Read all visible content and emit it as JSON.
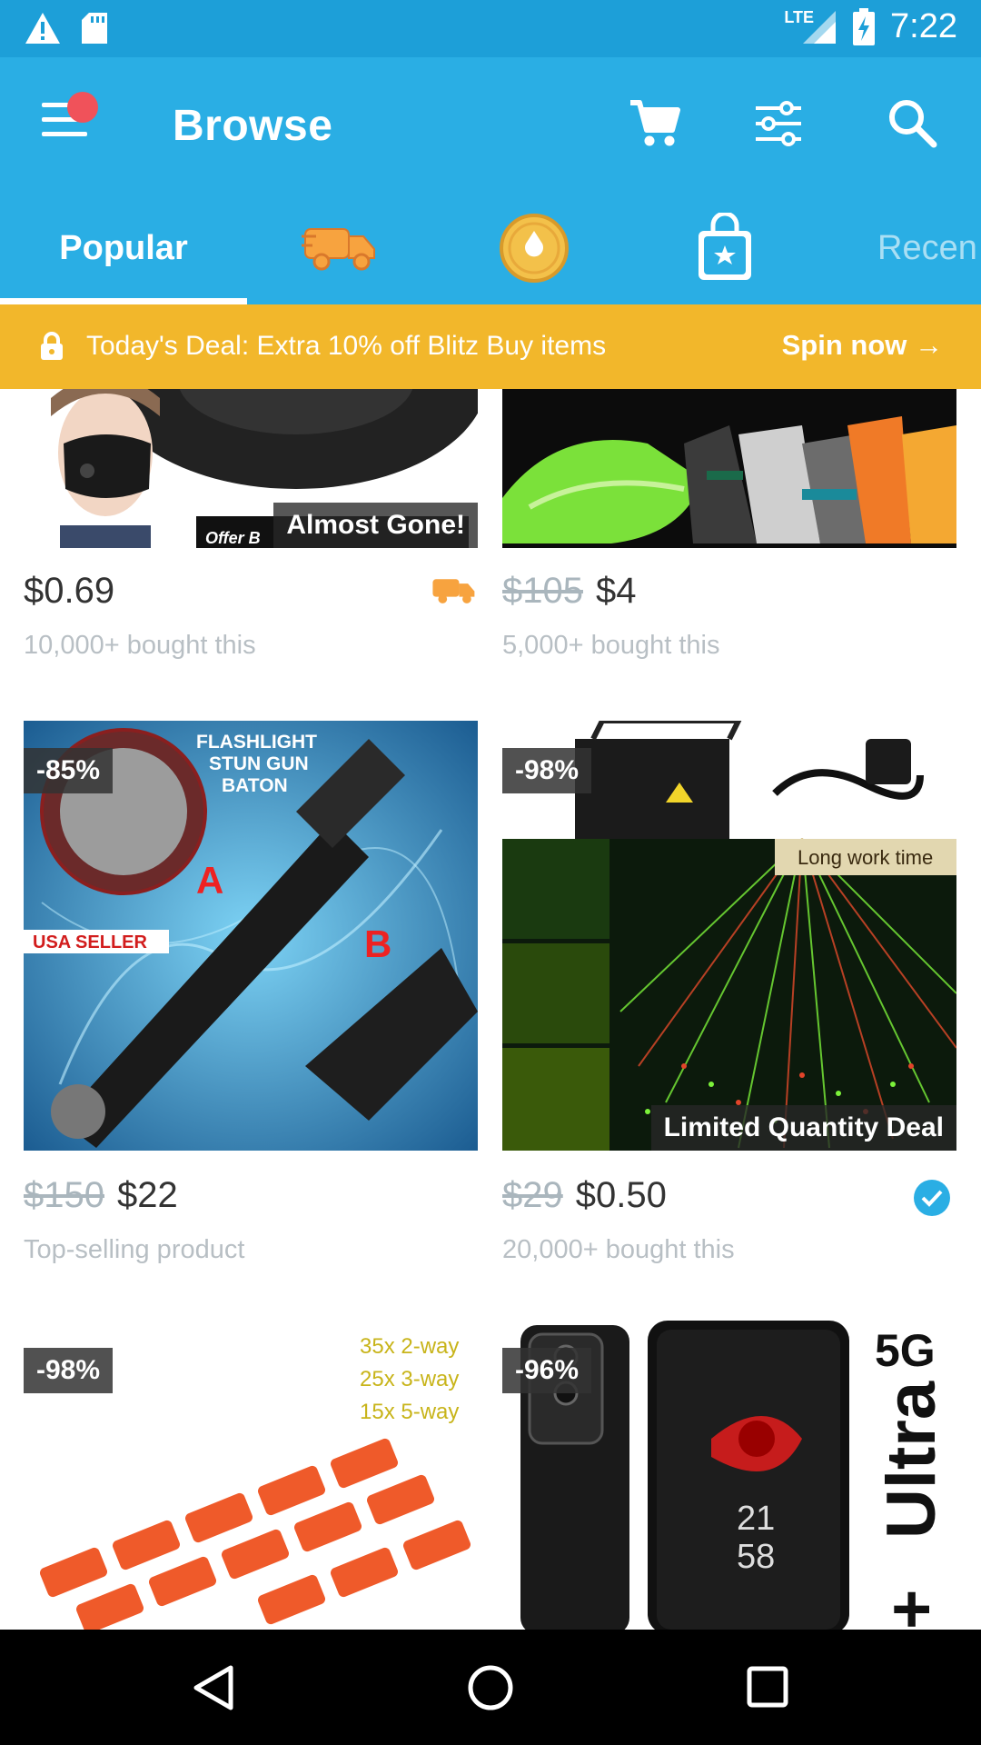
{
  "status_bar": {
    "time": "7:22",
    "network": "LTE"
  },
  "app_bar": {
    "title": "Browse",
    "icons": [
      "menu-icon",
      "cart-icon",
      "filter-icon",
      "search-icon"
    ]
  },
  "tabs": {
    "popular": "Popular",
    "recent": "Recen",
    "icon_tabs": [
      "delivery-truck-icon",
      "gold-coin-icon",
      "shopping-bag-icon"
    ]
  },
  "deal_banner": {
    "text": "Today's Deal: Extra 10% off Blitz Buy items",
    "action": "Spin now"
  },
  "products": [
    {
      "price": "$0.69",
      "old_price": "",
      "subtitle": "10,000+ bought this",
      "tag": "Almost Gone!",
      "badge": "",
      "image_text": "Offer B"
    },
    {
      "price": "$4",
      "old_price": "$105",
      "subtitle": "5,000+ bought this",
      "tag": "",
      "badge": ""
    },
    {
      "price": "$22",
      "old_price": "$150",
      "subtitle": "Top-selling product",
      "tag": "",
      "badge": "-85%",
      "image_text": [
        "FLASHLIGHT",
        "STUN GUN",
        "BATON",
        "USA SELLER",
        "A",
        "B"
      ]
    },
    {
      "price": "$0.50",
      "old_price": "$29",
      "subtitle": "20,000+ bought this",
      "tag": "Limited Quantity Deal",
      "badge": "-98%",
      "image_text": "Long work time"
    },
    {
      "badge": "-98%",
      "image_text": [
        "35x 2-way",
        "25x 3-way",
        "15x 5-way"
      ]
    },
    {
      "badge": "-96%",
      "image_text": [
        "5G",
        "Ultra",
        "21",
        "58"
      ]
    }
  ],
  "colors": {
    "primary": "#2aaee4",
    "status_bar": "#1d9fd8",
    "deal": "#f2b72b",
    "notification_dot": "#f0525a",
    "verified": "#2aaee4"
  }
}
